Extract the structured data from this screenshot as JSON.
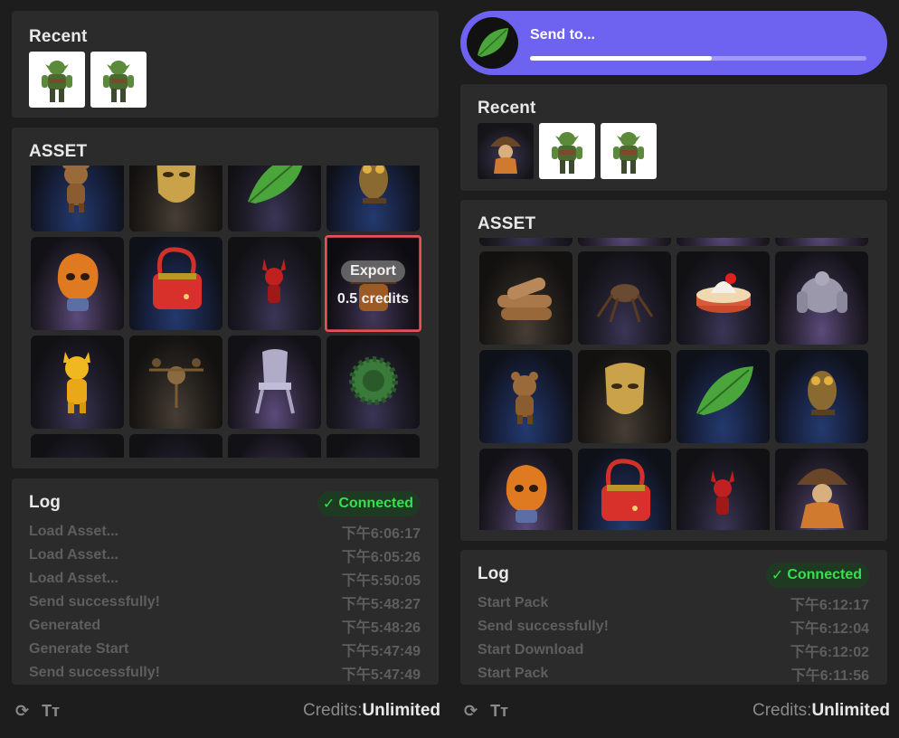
{
  "left": {
    "recent": {
      "title": "Recent"
    },
    "asset": {
      "title": "ASSET"
    },
    "export": {
      "label": "Export",
      "credits": "0.5 credits"
    },
    "log": {
      "title": "Log",
      "status": "Connected",
      "entries": [
        {
          "message": "Load Asset...",
          "time": "下午6:06:17"
        },
        {
          "message": "Load Asset...",
          "time": "下午6:05:26"
        },
        {
          "message": "Load Asset...",
          "time": "下午5:50:05"
        },
        {
          "message": "Send successfully!",
          "time": "下午5:48:27"
        },
        {
          "message": "Generated",
          "time": "下午5:48:26"
        },
        {
          "message": "Generate Start",
          "time": "下午5:47:49"
        },
        {
          "message": "Send successfully!",
          "time": "下午5:47:49"
        }
      ]
    },
    "footer": {
      "refresh_icon": "refresh-icon",
      "text_size_icon": "text-size-icon",
      "credits_label": "Credits:",
      "credits_value": "Unlimited"
    }
  },
  "right": {
    "send_to": {
      "label": "Send to...",
      "progress": 0.54
    },
    "recent": {
      "title": "Recent"
    },
    "asset": {
      "title": "ASSET"
    },
    "log": {
      "title": "Log",
      "status": "Connected",
      "entries": [
        {
          "message": "Start Pack",
          "time": "下午6:12:17"
        },
        {
          "message": "Send successfully!",
          "time": "下午6:12:04"
        },
        {
          "message": "Start Download",
          "time": "下午6:12:02"
        },
        {
          "message": "Start Pack",
          "time": "下午6:11:56"
        }
      ]
    },
    "footer": {
      "credits_label": "Credits:",
      "credits_value": "Unlimited"
    }
  },
  "colors": {
    "accent": "#6d63f0",
    "connected": "#36e04d",
    "selected_outline": "#e8515a",
    "panel": "#2b2b2b"
  }
}
